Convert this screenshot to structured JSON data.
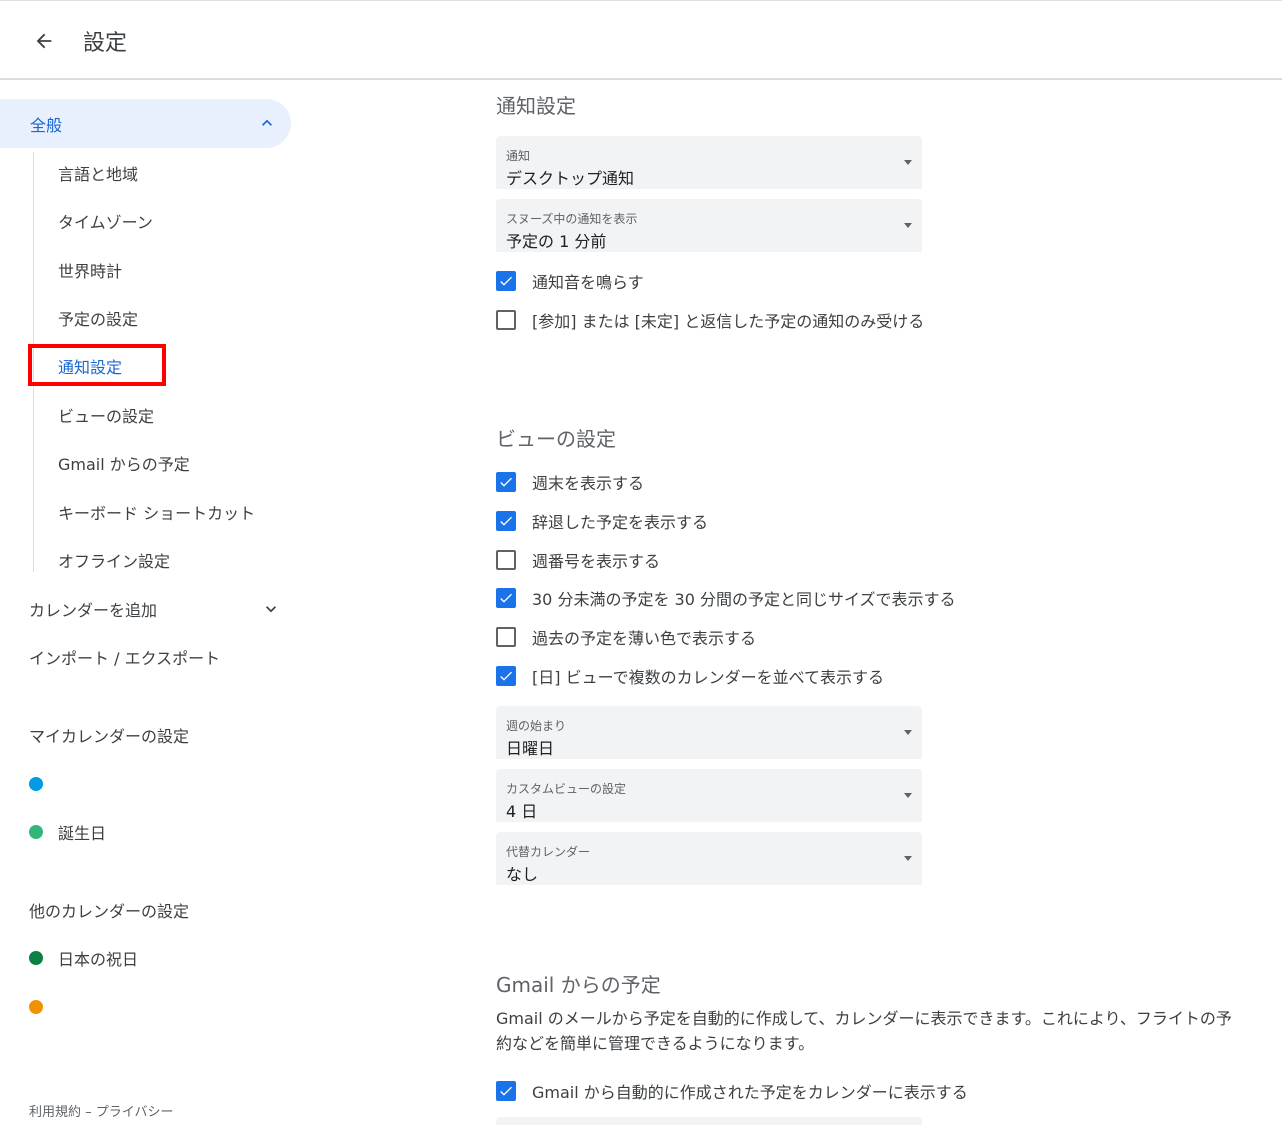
{
  "header": {
    "title": "設定"
  },
  "sidebar": {
    "general": "全般",
    "sub_items": [
      "言語と地域",
      "タイムゾーン",
      "世界時計",
      "予定の設定",
      "通知設定",
      "ビューの設定",
      "Gmail からの予定",
      "キーボード ショートカット",
      "オフライン設定"
    ],
    "active_sub_item": "通知設定",
    "add_calendar": "カレンダーを追加",
    "import_export": "インポート / エクスポート",
    "my_calendars_heading": "マイカレンダーの設定",
    "my_calendars": [
      {
        "name": "",
        "color": "#039be5"
      },
      {
        "name": "誕生日",
        "color": "#33b679"
      }
    ],
    "other_calendars_heading": "他のカレンダーの設定",
    "other_calendars": [
      {
        "name": "日本の祝日",
        "color": "#0b8043"
      },
      {
        "name": "",
        "color": "#f09300"
      }
    ],
    "footer": {
      "terms": "利用規約",
      "separator": "–",
      "privacy": "プライバシー"
    }
  },
  "notifications": {
    "title": "通知設定",
    "select_notification": {
      "label": "通知",
      "value": "デスクトップ通知"
    },
    "select_snoozed": {
      "label": "スヌーズ中の通知を表示",
      "value": "予定の 1 分前"
    },
    "checks": [
      {
        "label": "通知音を鳴らす",
        "checked": true
      },
      {
        "label": "[参加] または [未定] と返信した予定の通知のみ受ける",
        "checked": false
      }
    ]
  },
  "view_settings": {
    "title": "ビューの設定",
    "checks": [
      {
        "label": "週末を表示する",
        "checked": true
      },
      {
        "label": "辞退した予定を表示する",
        "checked": true
      },
      {
        "label": "週番号を表示する",
        "checked": false
      },
      {
        "label": "30 分未満の予定を 30 分間の予定と同じサイズで表示する",
        "checked": true
      },
      {
        "label": "過去の予定を薄い色で表示する",
        "checked": false
      },
      {
        "label": "[日] ビューで複数のカレンダーを並べて表示する",
        "checked": true
      }
    ],
    "select_week_start": {
      "label": "週の始まり",
      "value": "日曜日"
    },
    "select_custom_view": {
      "label": "カスタムビューの設定",
      "value": "4 日"
    },
    "select_alt_calendar": {
      "label": "代替カレンダー",
      "value": "なし"
    }
  },
  "gmail": {
    "title": "Gmail からの予定",
    "description": "Gmail のメールから予定を自動的に作成して、カレンダーに表示できます。これにより、フライトの予約などを簡単に管理できるようになります。",
    "check": {
      "label": "Gmail から自動的に作成された予定をカレンダーに表示する",
      "checked": true
    }
  },
  "colors": {
    "accent": "#1a73e8",
    "active_text": "#1967d2",
    "active_bg": "#e8f0fe",
    "highlight": "#ff0000"
  }
}
